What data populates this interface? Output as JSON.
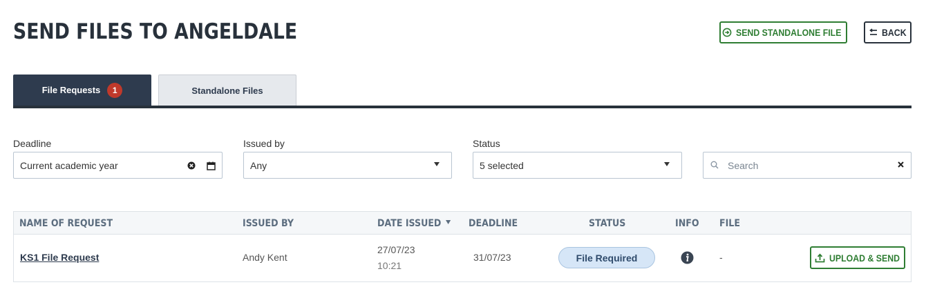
{
  "header": {
    "title": "SEND FILES TO ANGELDALE",
    "send_standalone_label": "SEND STANDALONE FILE",
    "back_label": "BACK"
  },
  "tabs": [
    {
      "label": "File Requests",
      "badge": "1",
      "active": true
    },
    {
      "label": "Standalone Files",
      "active": false
    }
  ],
  "filters": {
    "deadline": {
      "label": "Deadline",
      "value": "Current academic year"
    },
    "issued_by": {
      "label": "Issued by",
      "value": "Any"
    },
    "status": {
      "label": "Status",
      "value": "5 selected"
    },
    "search": {
      "placeholder": "Search"
    }
  },
  "table": {
    "columns": [
      "NAME OF REQUEST",
      "ISSUED BY",
      "DATE ISSUED",
      "DEADLINE",
      "STATUS",
      "INFO",
      "FILE"
    ],
    "sorted_column": "DATE ISSUED",
    "rows": [
      {
        "name": "KS1 File Request",
        "issued_by": "Andy Kent",
        "date_issued": "27/07/23",
        "time_issued": "10:21",
        "deadline": "31/07/23",
        "status": "File Required",
        "file": "-",
        "action_label": "UPLOAD & SEND"
      }
    ]
  },
  "colors": {
    "primary_dark": "#2e3b4e",
    "accent_green": "#2e7d32",
    "badge_red": "#c0392b",
    "status_pill": "#d6e6f7"
  },
  "icons": [
    "send-circle-icon",
    "back-arrow-icon",
    "clear-circle-icon",
    "calendar-icon",
    "caret-down-icon",
    "search-icon",
    "close-icon",
    "sort-down-icon",
    "info-icon",
    "upload-icon"
  ]
}
